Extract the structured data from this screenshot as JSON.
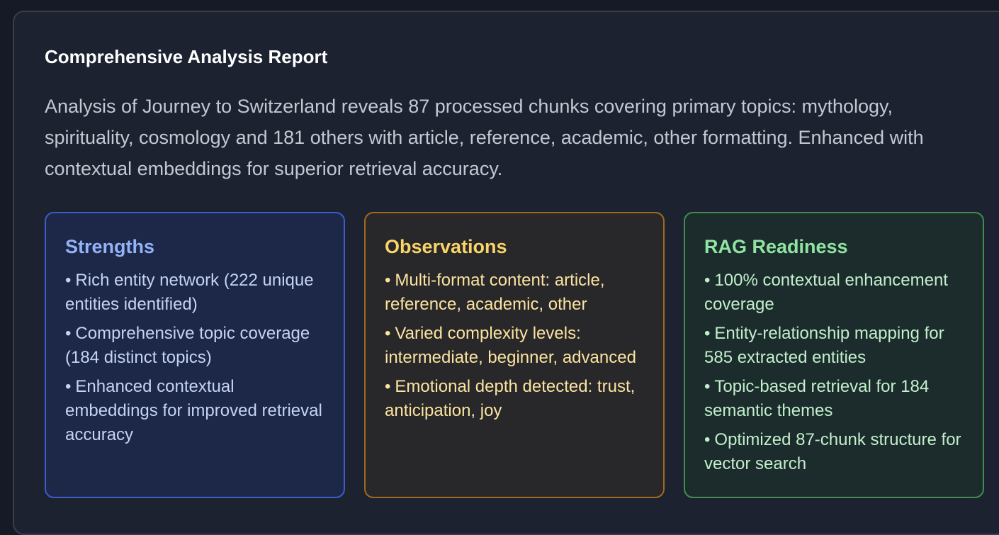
{
  "report": {
    "title": "Comprehensive Analysis Report",
    "summary": "Analysis of Journey to Switzerland reveals 87 processed chunks covering primary topics: mythology, spirituality, cosmology and 181 others with article, reference, academic, other formatting. Enhanced with contextual embeddings for superior retrieval accuracy."
  },
  "bullet_glyph": "•",
  "cards": {
    "strengths": {
      "title": "Strengths",
      "items": [
        "Rich entity network (222 unique entities identified)",
        "Comprehensive topic coverage (184 distinct topics)",
        "Enhanced contextual embeddings for improved retrieval accuracy"
      ]
    },
    "observations": {
      "title": "Observations",
      "items": [
        "Multi-format content: article, reference, academic, other",
        "Varied complexity levels: intermediate, beginner, advanced",
        "Emotional depth detected: trust, anticipation, joy"
      ]
    },
    "rag": {
      "title": "RAG Readiness",
      "items": [
        "100% contextual enhancement coverage",
        "Entity-relationship mapping for 585 extracted entities",
        "Topic-based retrieval for 184 semantic themes",
        "Optimized 87-chunk structure for vector search"
      ]
    }
  },
  "colors": {
    "page_background": "#151a26",
    "panel_background": "#1c2230",
    "strengths_accent": "#93b2f8",
    "observations_accent": "#f9d568",
    "rag_accent": "#8fe4a2"
  }
}
